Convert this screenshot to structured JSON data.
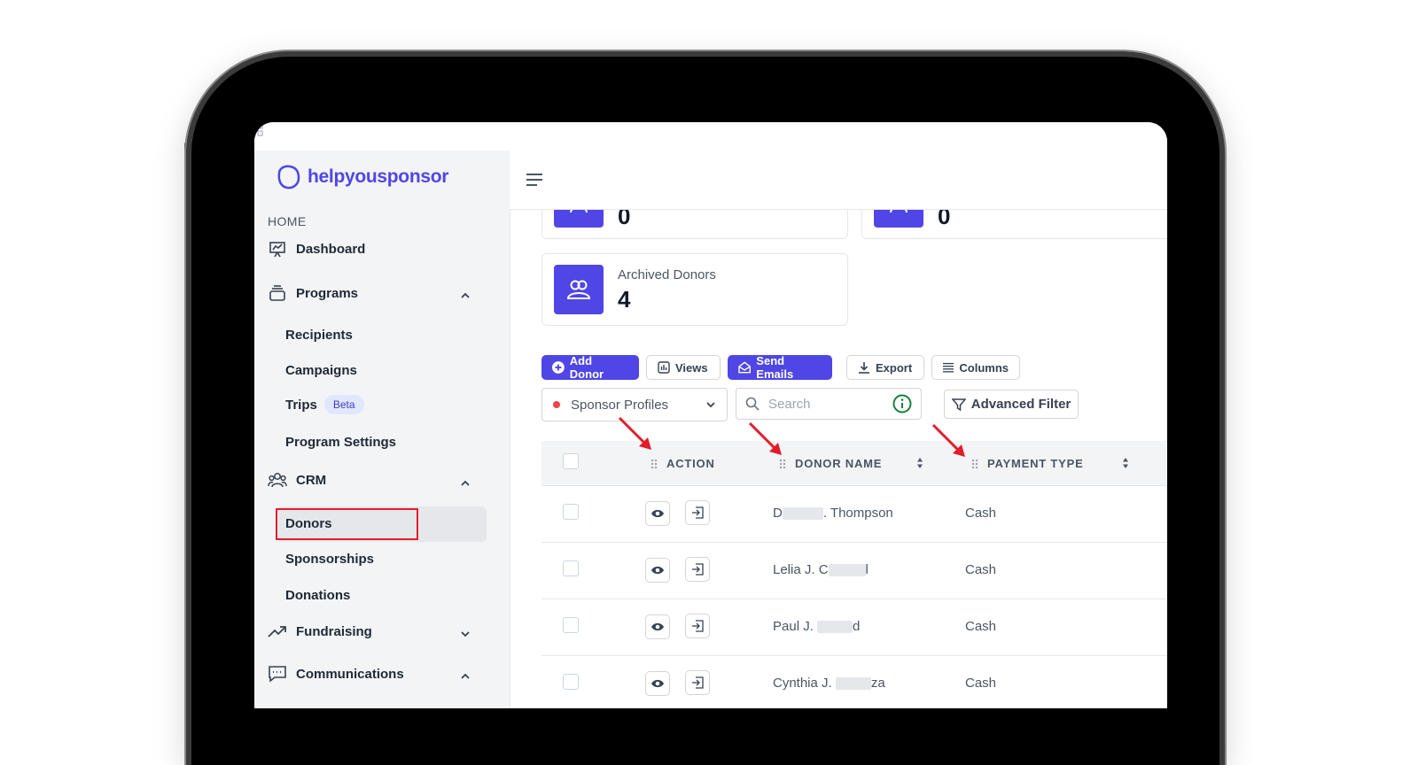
{
  "sidebar": {
    "brand": "helpyousponsor",
    "section_home": "HOME",
    "dashboard": "Dashboard",
    "programs": "Programs",
    "recipients": "Recipients",
    "campaigns": "Campaigns",
    "trips": "Trips",
    "trips_badge": "Beta",
    "program_settings": "Program Settings",
    "crm": "CRM",
    "donors": "Donors",
    "sponsorships": "Sponsorships",
    "donations": "Donations",
    "fundraising": "Fundraising",
    "communications": "Communications"
  },
  "stats": {
    "card1_value": "0",
    "card2_value": "0",
    "archived_label": "Archived Donors",
    "archived_value": "4"
  },
  "toolbar": {
    "add_donor": "Add Donor",
    "views": "Views",
    "send_emails": "Send Emails",
    "export": "Export",
    "columns": "Columns"
  },
  "filters": {
    "profile_select": "Sponsor Profiles",
    "search_placeholder": "Search",
    "advanced_filter": "Advanced Filter"
  },
  "table": {
    "columns": [
      "ACTION",
      "DONOR NAME",
      "PAYMENT TYPE"
    ],
    "rows": [
      {
        "name_start": "D",
        "name_end": ". Thompson",
        "payment": "Cash"
      },
      {
        "name_start": "Lelia J. C",
        "name_end": "l",
        "payment": "Cash"
      },
      {
        "name_start": "Paul J. ",
        "name_end": "d",
        "payment": "Cash"
      },
      {
        "name_start": "Cynthia J. ",
        "name_end": "za",
        "payment": "Cash"
      }
    ]
  },
  "colors": {
    "accent": "#4f46e5",
    "highlight_border": "#e11d2b"
  }
}
